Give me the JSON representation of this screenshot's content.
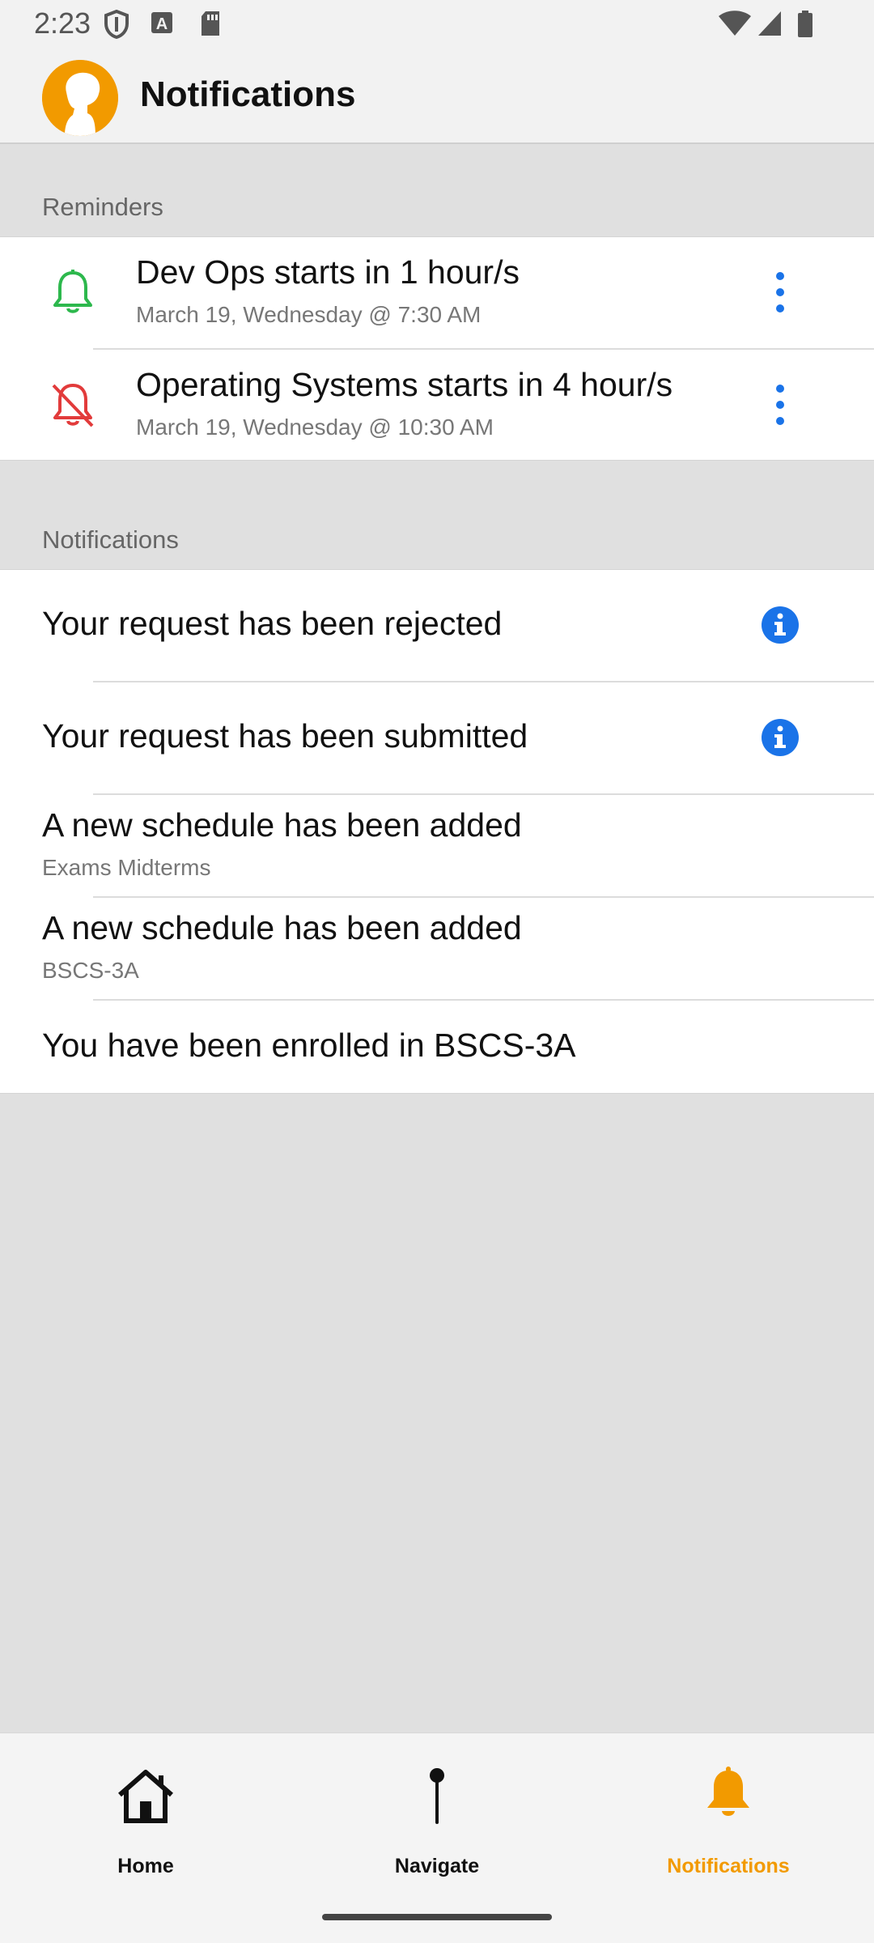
{
  "status_bar": {
    "time": "2:23",
    "icons": [
      "shield-icon",
      "font-a-icon",
      "sd-card-icon",
      "wifi-icon",
      "signal-icon",
      "battery-icon"
    ]
  },
  "header": {
    "title": "Notifications",
    "logo": "profile-silhouette-icon",
    "accent_color": "#f29a00"
  },
  "reminders": {
    "section_label": "Reminders",
    "items": [
      {
        "title": "Dev Ops starts in 1 hour/s",
        "subtitle": "March 19, Wednesday @ 7:30 AM",
        "icon": "bell-icon",
        "icon_color": "#2db84d",
        "menu_icon": "more-vertical-icon"
      },
      {
        "title": "Operating Systems starts in 4 hour/s",
        "subtitle": "March 19, Wednesday @ 10:30 AM",
        "icon": "bell-off-icon",
        "icon_color": "#e23b3b",
        "menu_icon": "more-vertical-icon"
      }
    ]
  },
  "notifications": {
    "section_label": "Notifications",
    "items": [
      {
        "title": "Your request has been rejected",
        "subtitle": "",
        "icon": "info-icon"
      },
      {
        "title": "Your request has been submitted",
        "subtitle": "",
        "icon": "info-icon"
      },
      {
        "title": "A new schedule has been added",
        "subtitle": "Exams Midterms"
      },
      {
        "title": "A new schedule has been added",
        "subtitle": "BSCS-3A"
      },
      {
        "title": "You have been enrolled in BSCS-3A",
        "subtitle": ""
      }
    ],
    "info_color": "#1a73e8"
  },
  "bottom_nav": {
    "items": [
      {
        "label": "Home",
        "icon": "home-icon",
        "active": false
      },
      {
        "label": "Navigate",
        "icon": "pin-icon",
        "active": false
      },
      {
        "label": "Notifications",
        "icon": "bell-icon",
        "active": true
      }
    ],
    "active_color": "#f29a00"
  }
}
